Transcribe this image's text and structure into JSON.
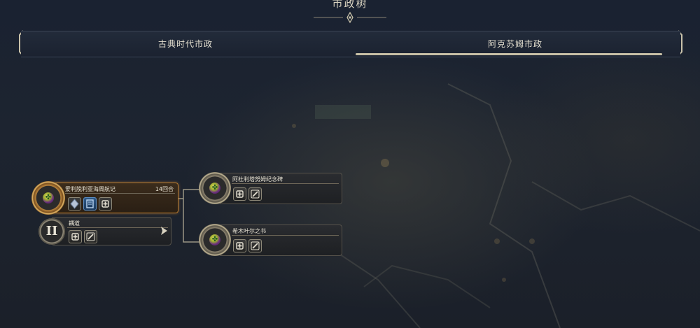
{
  "window_title": "市政树",
  "tabs": [
    {
      "label": "古典时代市政",
      "active": false
    },
    {
      "label": "阿克苏姆市政",
      "active": true
    }
  ],
  "nodes": {
    "main": {
      "title": "爱利脱利亚海周航记",
      "turns": "14回合",
      "selected": true,
      "icons": [
        "diamond-icon",
        "scroll-icon",
        "plus-icon"
      ]
    },
    "branch_a": {
      "title": "阿杜利塔努姆纪念碑",
      "icons": [
        "plus-icon",
        "pen-icon"
      ]
    },
    "branch_b": {
      "title": "希木叶尔之书",
      "icons": [
        "plus-icon",
        "pen-icon"
      ]
    },
    "row2": {
      "numeral": "II",
      "title": "耦道",
      "icons": [
        "plus-icon",
        "pen-icon"
      ]
    }
  },
  "colors": {
    "accent": "#b77a2e",
    "text": "#e6e0cf",
    "background": "#1c2330"
  }
}
